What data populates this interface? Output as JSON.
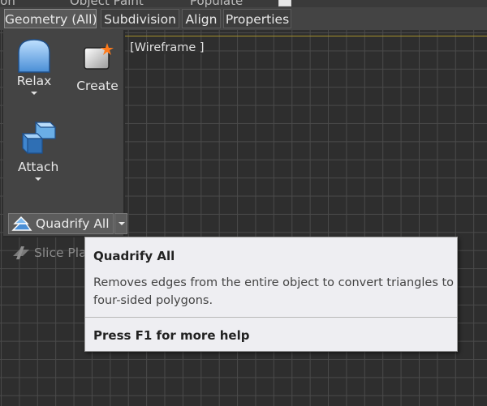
{
  "menu": {
    "items": [
      "ion",
      "Object Paint",
      "Populate"
    ]
  },
  "tabs": [
    {
      "label": "Geometry (All)",
      "active": true
    },
    {
      "label": "Subdivision",
      "active": false
    },
    {
      "label": "Align",
      "active": false
    },
    {
      "label": "Properties",
      "active": false
    }
  ],
  "viewport": {
    "label": "[Wireframe ]"
  },
  "tools": {
    "relax": {
      "label": "Relax",
      "icon": "relax-icon"
    },
    "create": {
      "label": "Create",
      "icon": "create-icon"
    },
    "attach": {
      "label": "Attach",
      "icon": "attach-icon"
    },
    "quadrify": {
      "label": "Quadrify All",
      "icon": "quadrify-icon"
    },
    "slice": {
      "label": "Slice Plane",
      "icon": "slice-plane-icon"
    }
  },
  "tooltip": {
    "title": "Quadrify All",
    "description": "Removes edges from the entire object to convert triangles to four-sided polygons.",
    "help": "Press F1 for more help"
  },
  "colors": {
    "accent_line": "#a38f2c",
    "tooltip_bg": "#eeeef2",
    "panel_bg": "#444444"
  }
}
